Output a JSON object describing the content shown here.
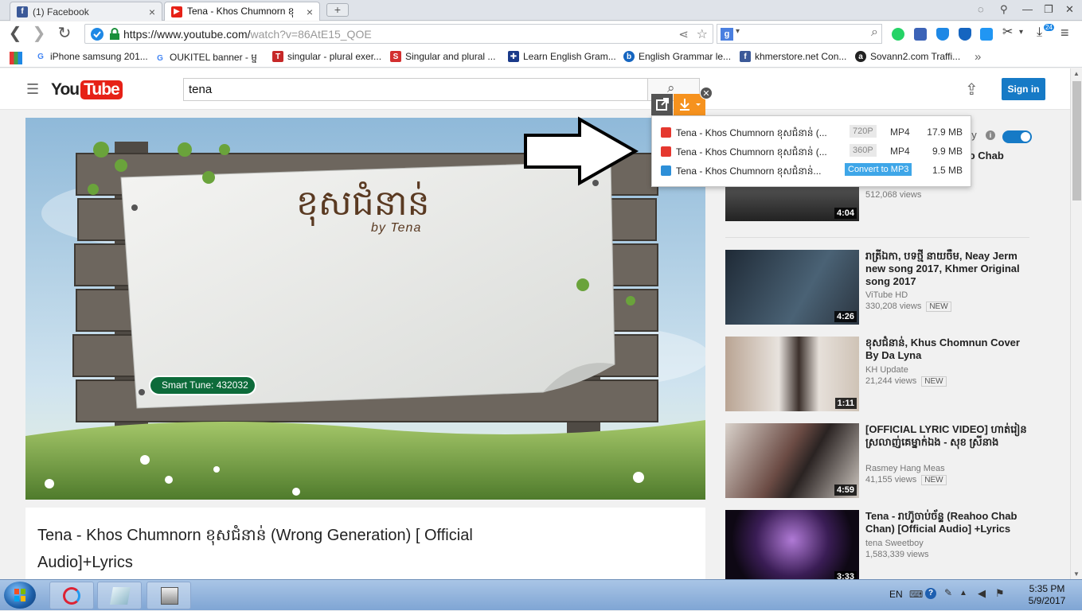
{
  "browser": {
    "tabs": [
      {
        "title": "(1) Facebook",
        "close": "×"
      },
      {
        "title": "Tena - Khos Chumnorn ខុ",
        "close": "×"
      }
    ],
    "new_tab": "+",
    "url_main": "https://www.youtube.com/",
    "url_rest": "watch?v=86AtE15_QOE",
    "search_engine_badge": "g",
    "bookmarks": [
      {
        "label": "iPhone samsung 201...",
        "icon": "G"
      },
      {
        "label": "OUKITEL banner - ម្ន",
        "icon": "G"
      },
      {
        "label": "singular - plural exer...",
        "icon": "T"
      },
      {
        "label": "Singular and plural ...",
        "icon": "S"
      },
      {
        "label": "Learn English Gram...",
        "icon": "flag"
      },
      {
        "label": "English Grammar le...",
        "icon": "b"
      },
      {
        "label": "khmerstore.net Con...",
        "icon": "f"
      },
      {
        "label": "Sovann2.com Traffi...",
        "icon": "a"
      }
    ],
    "bookmarks_more": "»",
    "ext_badge": "24"
  },
  "youtube": {
    "logo_you": "You",
    "logo_tube": "Tube",
    "search_value": "tena",
    "signin": "Sign in",
    "autoplay_tail": "ay",
    "video": {
      "title": "Tena - Khos Chumnorn ខុសជំនាន់ (Wrong Generation) [ Official Audio]+Lyrics",
      "overlay_title": "ខុសជំនាន់",
      "overlay_by": "by Tena",
      "smart_tune": "Smart Tune: 432032"
    },
    "related": [
      {
        "title": "Reahoo Chab",
        "views": "512,068 views",
        "duration": "4:04"
      },
      {
        "title": "រាត្រីឯកា, បទថ្មី នាយចឺម, Neay Jerm new song 2017, Khmer Original song 2017",
        "channel": "ViTube HD",
        "views": "330,208 views",
        "badge": "NEW",
        "duration": "4:26"
      },
      {
        "title": "ខុសជំនាន់, Khus Chomnun Cover By Da Lyna",
        "channel": "KH Update",
        "views": "21,244 views",
        "badge": "NEW",
        "duration": "1:11"
      },
      {
        "title": "[OFFICIAL LYRIC VIDEO] ហាត់រៀនស្រលាញ់គេម្នាក់ឯង - សុខ ស្រីនាង",
        "channel": "Rasmey Hang Meas",
        "views": "41,155 views",
        "badge": "NEW",
        "duration": "4:59"
      },
      {
        "title": "Tena - រាហ៊ូចាប់ច័ន្ទ (Reahoo Chab Chan) [Official Audio] +Lyrics",
        "channel": "tena Sweetboy",
        "views": "1,583,339 views",
        "duration": "3:33"
      }
    ]
  },
  "downloader": {
    "rows": [
      {
        "name": "Tena - Khos Chumnorn ខុសជំនាន់ (...",
        "quality": "720P",
        "format": "MP4",
        "size": "17.9 MB",
        "color": "#e5382f"
      },
      {
        "name": "Tena - Khos Chumnorn ខុសជំនាន់ (...",
        "quality": "360P",
        "format": "MP4",
        "size": "9.9 MB",
        "color": "#e5382f"
      },
      {
        "name": "Tena - Khos Chumnorn ខុសជំនាន់...",
        "action": "Convert to MP3",
        "size": "1.5 MB",
        "color": "#2d8fd8"
      }
    ]
  },
  "taskbar": {
    "lang": "EN",
    "time": "5:35 PM",
    "date": "5/9/2017"
  },
  "colors": {
    "yt_red": "#e62117",
    "signin_blue": "#167ac6",
    "dl_orange": "#f6921e"
  }
}
